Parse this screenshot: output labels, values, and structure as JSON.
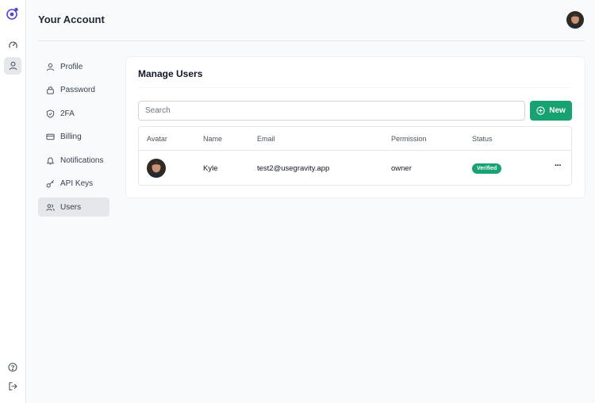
{
  "header": {
    "title": "Your Account"
  },
  "settings_nav": {
    "items": [
      {
        "label": "Profile",
        "icon": "user-icon",
        "active": false
      },
      {
        "label": "Password",
        "icon": "lock-icon",
        "active": false
      },
      {
        "label": "2FA",
        "icon": "shield-icon",
        "active": false
      },
      {
        "label": "Billing",
        "icon": "credit-card-icon",
        "active": false
      },
      {
        "label": "Notifications",
        "icon": "bell-icon",
        "active": false
      },
      {
        "label": "API Keys",
        "icon": "key-icon",
        "active": false
      },
      {
        "label": "Users",
        "icon": "users-icon",
        "active": true
      }
    ]
  },
  "rail": {
    "icons": [
      "logo-icon",
      "dashboard-gauge-icon",
      "account-user-icon",
      "help-icon",
      "sign-out-icon"
    ]
  },
  "main": {
    "title": "Manage Users",
    "search": {
      "placeholder": "Search",
      "value": ""
    },
    "new_button": {
      "label": "New",
      "icon": "plus-circle-icon"
    },
    "table": {
      "columns": [
        "Avatar",
        "Name",
        "Email",
        "Permission",
        "Status"
      ],
      "rows": [
        {
          "name": "Kyle",
          "email": "test2@usegravity.app",
          "permission": "owner",
          "status": "Verified",
          "actions": "···"
        }
      ]
    }
  },
  "colors": {
    "accent": "#16a371",
    "brand": "#4f46e5",
    "background": "#f9fafb",
    "active_nav": "#e5e7eb"
  }
}
